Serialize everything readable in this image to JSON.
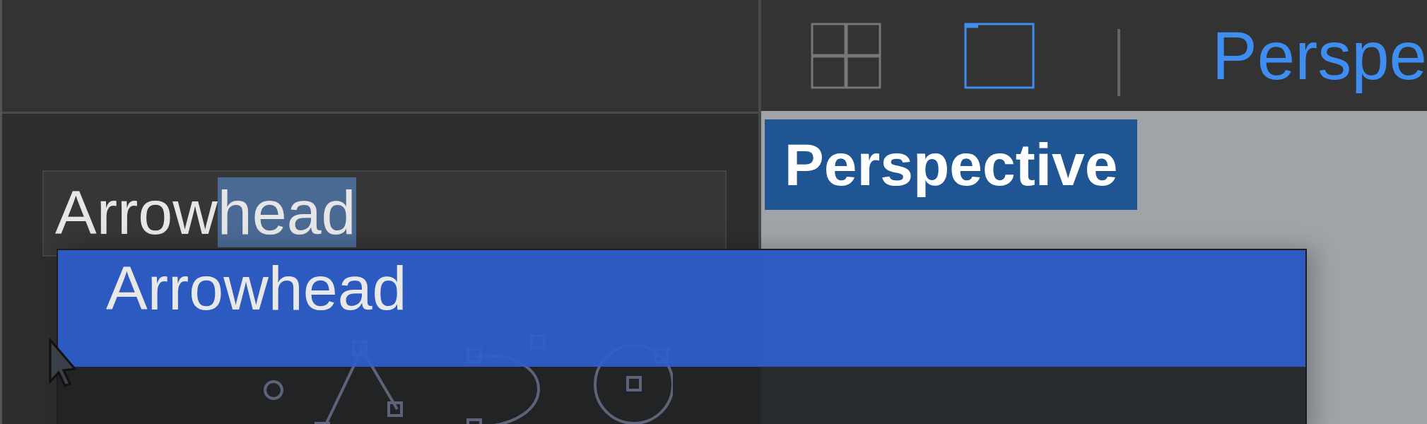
{
  "outliner": {
    "search": {
      "value_parts": [
        {
          "text": "Arrow",
          "selected": false
        },
        {
          "text": "head",
          "selected": true
        }
      ]
    },
    "dropdown": {
      "items": [
        {
          "label": "Arrowhead",
          "selected": true
        }
      ]
    }
  },
  "viewport_header": {
    "view_buttons": [
      {
        "kind": "quad",
        "selected": false
      },
      {
        "kind": "single",
        "selected": true
      }
    ],
    "title": "Perspe"
  },
  "viewport": {
    "label": "Perspective"
  }
}
